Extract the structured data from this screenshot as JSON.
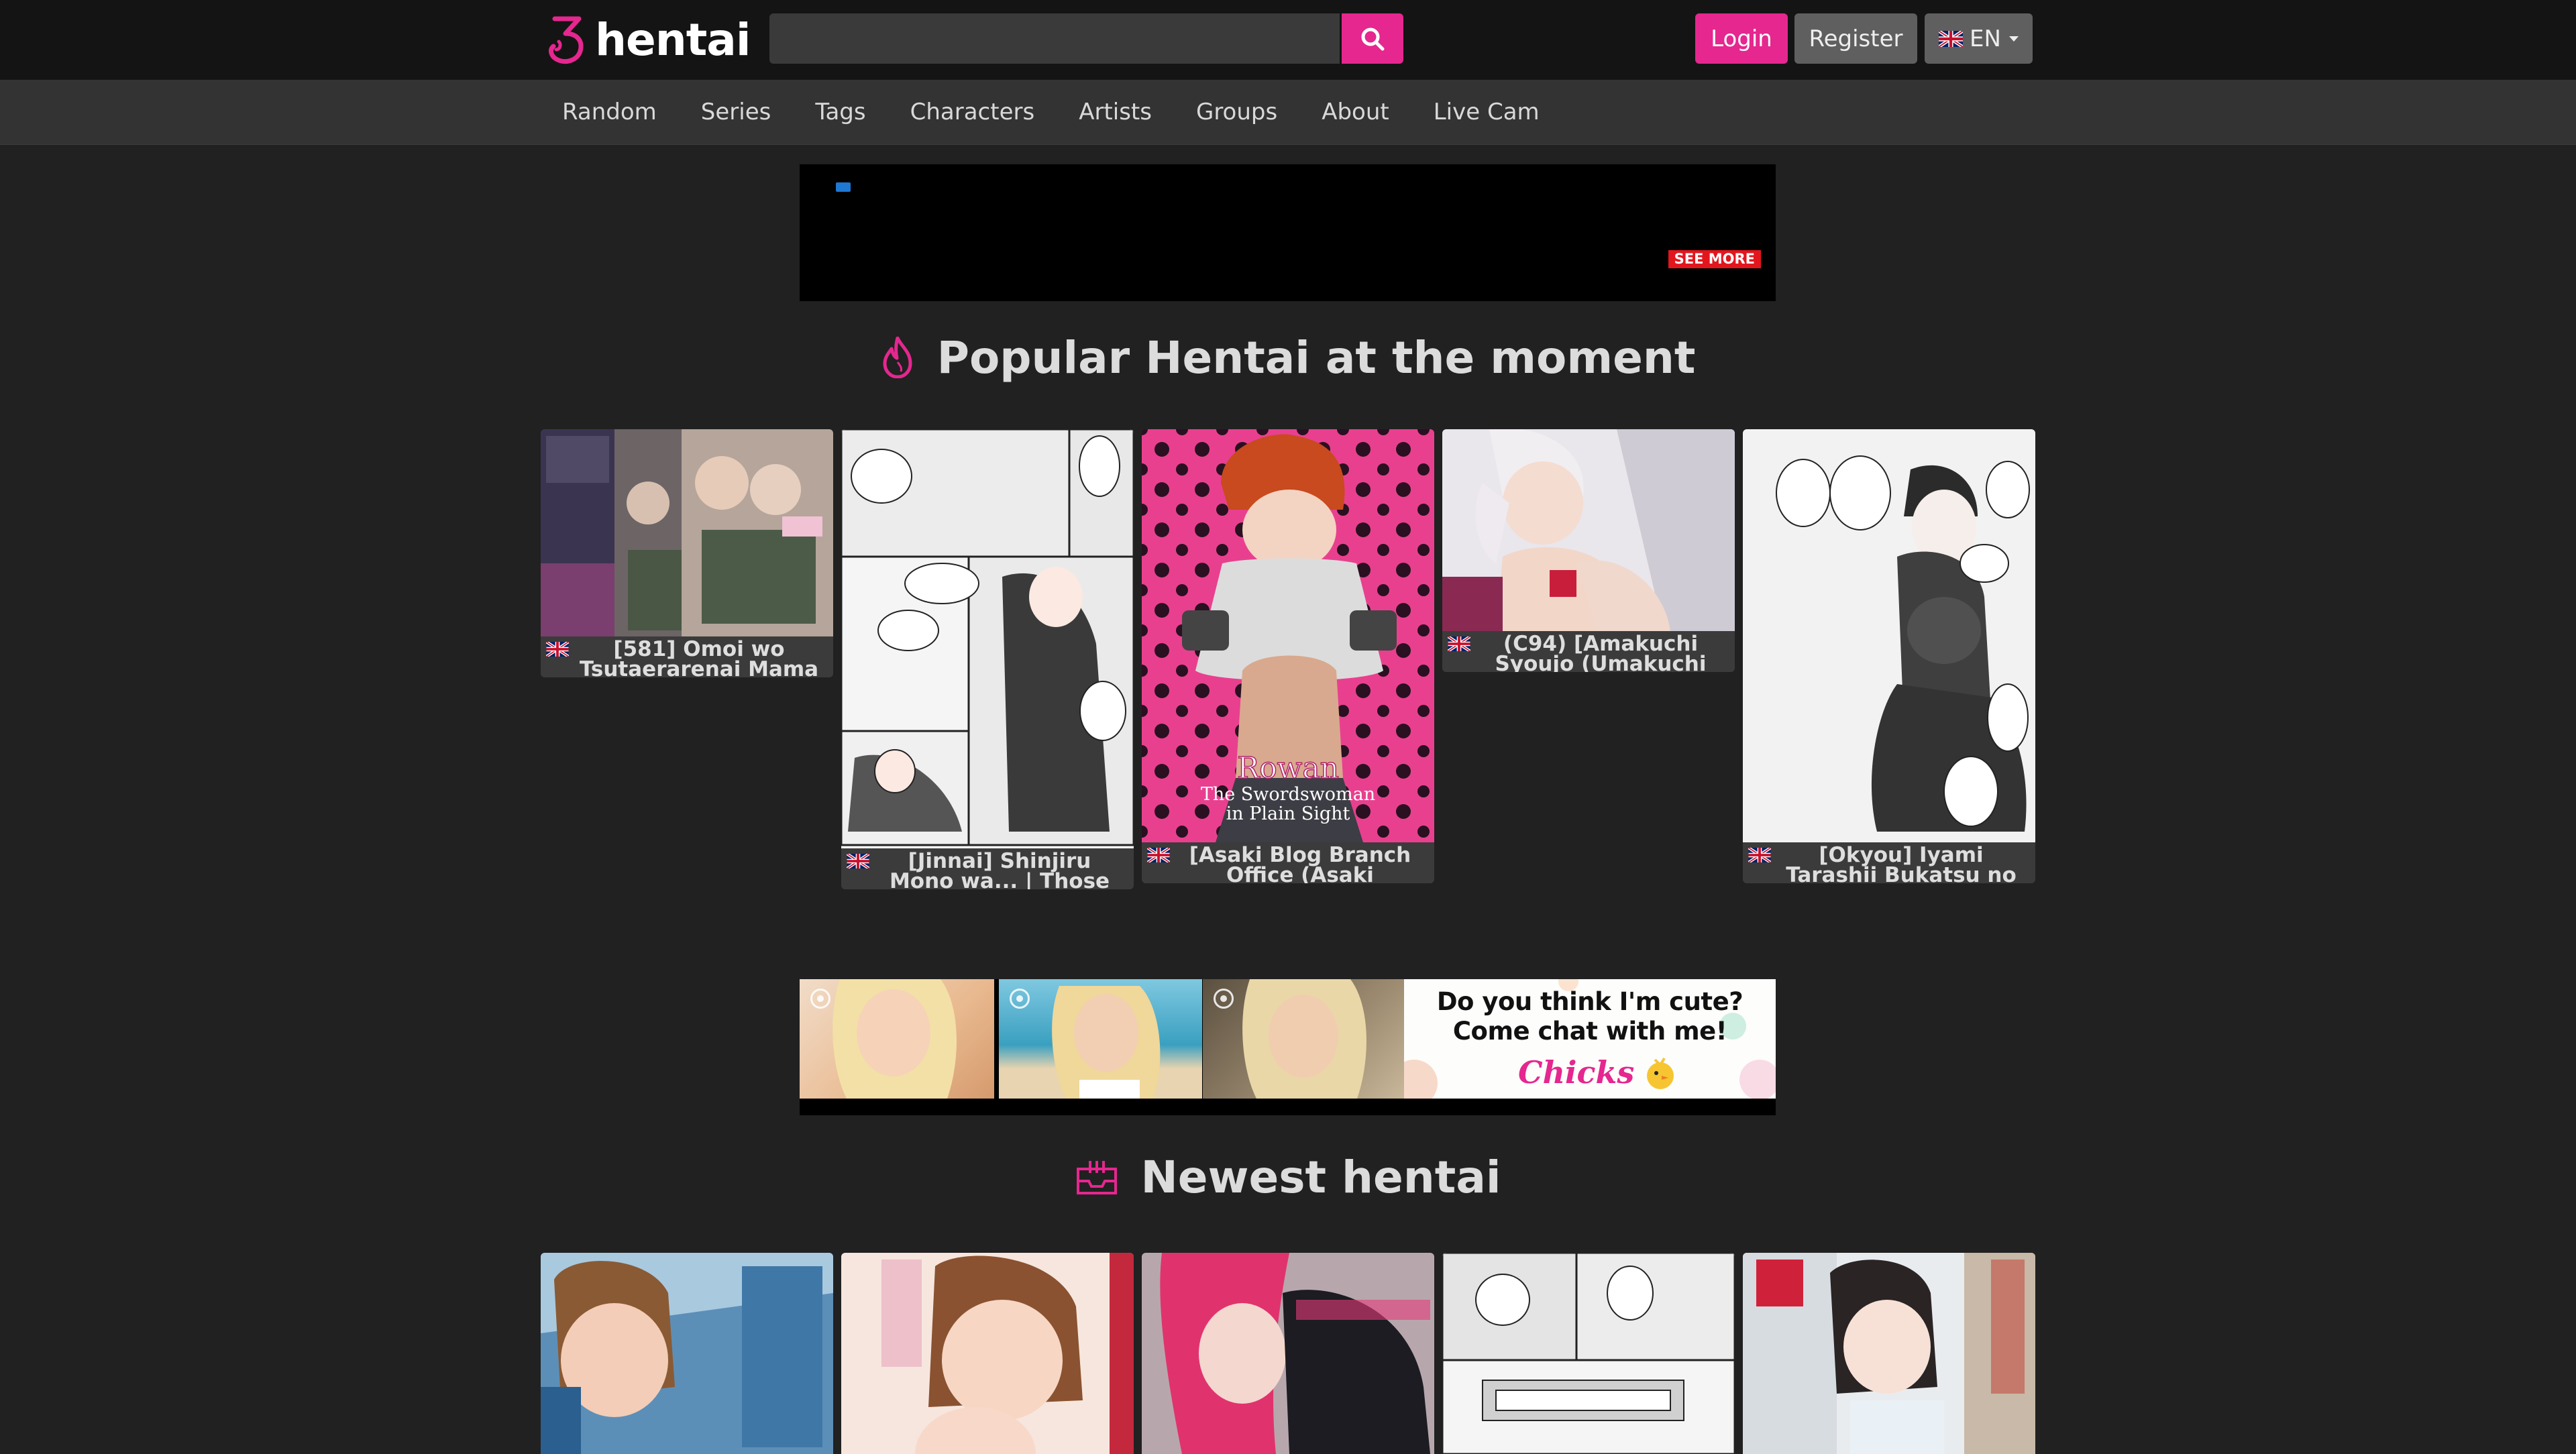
{
  "header": {
    "logo_text": "hentai",
    "search": {
      "placeholder": "",
      "value": ""
    },
    "login_label": "Login",
    "register_label": "Register",
    "language_label": "EN"
  },
  "nav": {
    "items": [
      "Random",
      "Series",
      "Tags",
      "Characters",
      "Artists",
      "Groups",
      "About",
      "Live Cam"
    ]
  },
  "ads": {
    "top": {
      "button_label": "SEE MORE"
    },
    "middle": {
      "headline_line1": "Do you think I'm cute?",
      "headline_line2": "Come chat with me!",
      "brand": "Chicks"
    }
  },
  "popular": {
    "title": "Popular Hentai at the moment",
    "items": [
      {
        "caption_line1": "[581] Omoi wo",
        "caption_line2": "Tsutaerarenai Mama |"
      },
      {
        "caption_line1": "[Jinnai] Shinjiru",
        "caption_line2": "Mono wa... | Those"
      },
      {
        "caption_line1": "[Asaki Blog Branch",
        "caption_line2": "Office (Asaki"
      },
      {
        "caption_line1": "(C94) [Amakuchi",
        "caption_line2": "Syoujo (Umakuchi"
      },
      {
        "caption_line1": "[Okyou] Iyami",
        "caption_line2": "Tarashii Bukatsu no"
      }
    ]
  },
  "cover_texts": {
    "rowan_title": "Rowan",
    "rowan_subtitle_1": "The Swordswoman",
    "rowan_subtitle_2": "in Plain Sight"
  },
  "newest": {
    "title": "Newest hentai"
  },
  "colors": {
    "accent": "#e5278f",
    "topbar": "#141414",
    "navbar": "#333333",
    "page_bg": "#212121",
    "card_caption_bg": "#3b3b3b"
  }
}
